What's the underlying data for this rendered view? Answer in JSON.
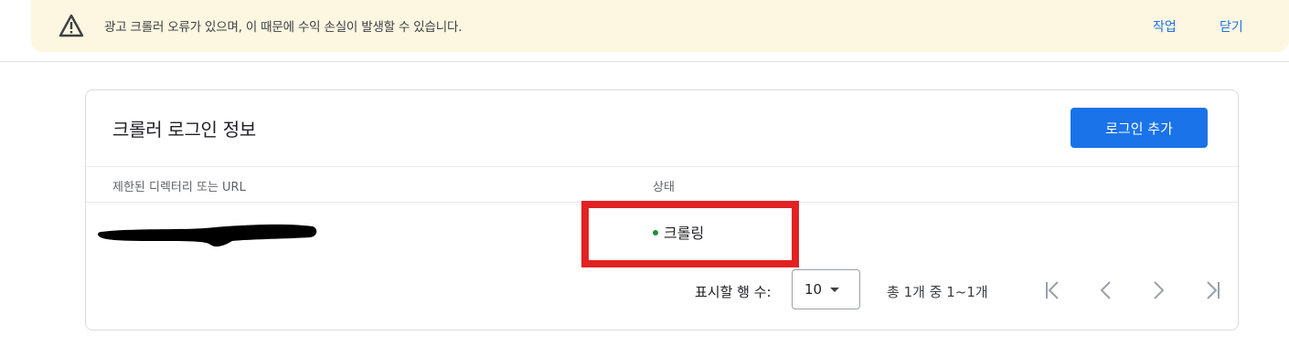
{
  "banner": {
    "icon": "warning-icon",
    "message": "광고 크롤러 오류가 있으며, 이 때문에 수익 손실이 발생할 수 있습니다.",
    "action_label": "작업",
    "close_label": "닫기",
    "background_color": "#fdf6e1"
  },
  "card": {
    "title": "크롤러 로그인 정보",
    "add_button_label": "로그인 추가",
    "button_color": "#1a73e8",
    "columns": {
      "url": "제한된 디렉터리 또는 URL",
      "status": "상태"
    },
    "rows": [
      {
        "url": "",
        "url_redacted": true,
        "status": "크롤링",
        "status_color": "#1e8e3e"
      }
    ]
  },
  "pagination": {
    "rows_per_page_label": "표시할 행 수:",
    "rows_per_page_value": "10",
    "range_label": "총 1개 중 1~1개",
    "icons": [
      "first-page-icon",
      "previous-page-icon",
      "next-page-icon",
      "last-page-icon"
    ]
  },
  "annotation": {
    "highlight_color": "#e22222"
  }
}
